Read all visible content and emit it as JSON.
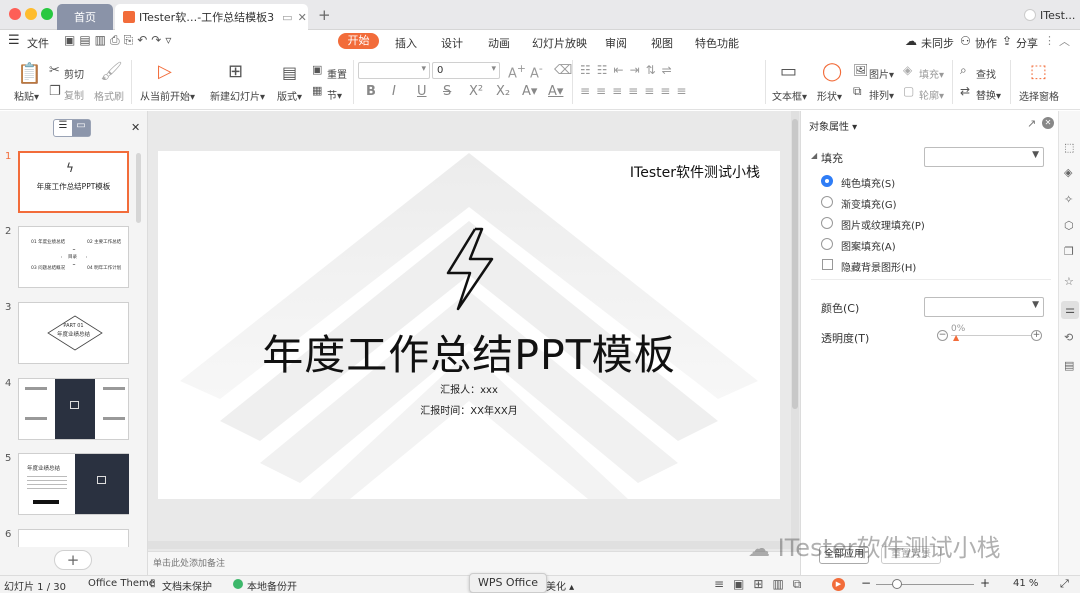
{
  "titlebar": {
    "home_tab": "首页",
    "doc_tab": "ITester软…-工作总结模板3",
    "user": "ITest..."
  },
  "menubar": {
    "file": "文件",
    "tabs": [
      "开始",
      "插入",
      "设计",
      "动画",
      "幻灯片放映",
      "审阅",
      "视图",
      "特色功能"
    ],
    "sync": "未同步",
    "collab": "协作",
    "share": "分享"
  },
  "ribbon": {
    "paste": "粘贴",
    "cut": "剪切",
    "copy": "复制",
    "format_painter": "格式刷",
    "from_current": "从当前开始",
    "new_slide": "新建幻灯片",
    "layout": "版式",
    "reset": "重置",
    "section": "节",
    "font_size": "0",
    "textbox": "文本框",
    "shape": "形状",
    "picture": "图片",
    "fill": "填充",
    "arrange": "排列",
    "outline": "轮廓",
    "find": "查找",
    "replace": "替换",
    "select_pane": "选择窗格"
  },
  "slide": {
    "brand": "ITester软件测试小栈",
    "title": "年度工作总结PPT模板",
    "reporter": "汇报人：xxx",
    "report_time": "汇报时间：XX年XX月"
  },
  "thumbs": {
    "nums": [
      "1",
      "2",
      "3",
      "4",
      "5",
      "6"
    ],
    "t1_title": "年度工作总结PPT模板",
    "t2_items": [
      "01 年度业绩总结",
      "02 主要工作总结",
      "03 问题总结概况",
      "04 明年工作计划"
    ],
    "t2_center": "目录",
    "t3_part": "PART 01",
    "t3_title": "年度业绩总结",
    "t5_title": "年度业绩总结"
  },
  "notes": {
    "placeholder": "单击此处添加备注"
  },
  "props": {
    "header": "对象属性",
    "fill_section": "填充",
    "options": [
      "纯色填充(S)",
      "渐变填充(G)",
      "图片或纹理填充(P)",
      "图案填充(A)"
    ],
    "hide_bg": "隐藏背景图形(H)",
    "color_label": "颜色(C)",
    "transparency_label": "透明度(T)",
    "transparency_value": "0%",
    "apply_all": "全部应用",
    "reset_bg": "重置背景"
  },
  "status": {
    "slide_count": "幻灯片 1 / 30",
    "theme": "Office Theme",
    "protect": "文档未保护",
    "backup": "本地备份开",
    "beautify": "美化",
    "zoom": "41 %",
    "app_popup": "WPS Office"
  },
  "watermark": "ITester软件测试小栈",
  "colors": {
    "accent": "#f26c3a",
    "thumb_dark": "#2a3140"
  }
}
